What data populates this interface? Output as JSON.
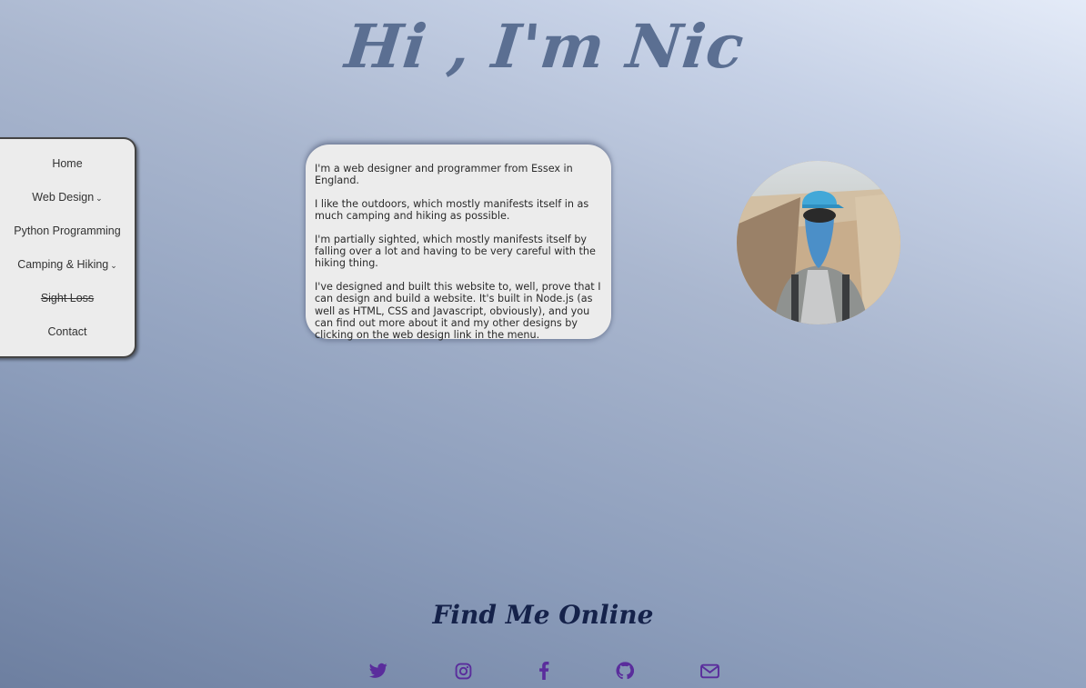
{
  "header": {
    "title": "Hi , I'm Nic"
  },
  "nav": {
    "items": [
      {
        "label": "Home"
      },
      {
        "label": "Web Design",
        "caret": "⌄"
      },
      {
        "label": "Python Programming"
      },
      {
        "label": "Camping & Hiking",
        "caret": "⌄"
      },
      {
        "label": "Sight Loss"
      },
      {
        "label": "Contact"
      }
    ]
  },
  "about": {
    "paragraphs": [
      "I'm a web designer and programmer from Essex in England.",
      "I like the outdoors, which mostly manifests itself in as much camping and hiking as possible.",
      "I'm partially sighted, which mostly manifests itself by falling over a lot and having to be very careful with the hiking thing.",
      "I've designed and built this website to, well, prove that I can design and build a website. It's built in Node.js (as well as HTML, CSS and Javascript, obviously), and you can find out more about it and my other designs by clicking on the web design link in the menu."
    ]
  },
  "profile": {
    "avatar_icon": "profile-photo"
  },
  "footer": {
    "heading": "Find Me Online",
    "icons": [
      "twitter-icon",
      "instagram-icon",
      "facebook-icon",
      "github-icon",
      "email-icon"
    ],
    "icon_color": "#5a2d9c"
  },
  "colors": {
    "title": "#5b6f92",
    "heading": "#15224a",
    "panel": "#ececec"
  }
}
